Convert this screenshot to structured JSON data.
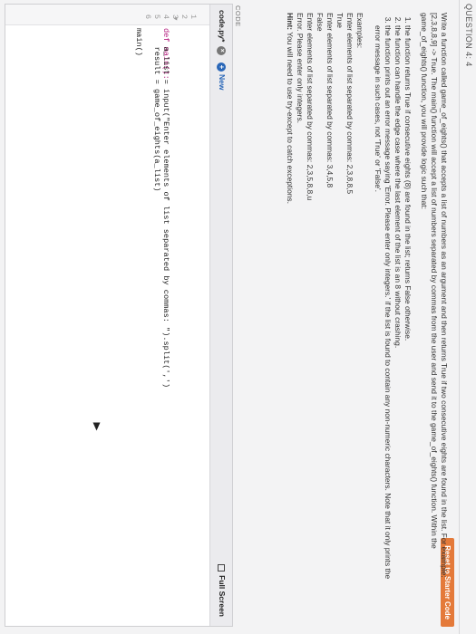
{
  "question": {
    "title": "QUESTION 4: 4"
  },
  "reset_button": {
    "label": "Reset to Starter Code"
  },
  "prompt": {
    "intro": "Write a function called game_of_eights() that accepts a list of numbers as an argument and then returns True if two consecutive eights are found in the list. For example: [2,3,8,8,9] -> True. The main() function will accept a list of numbers separated by commas from the user and send it to the game_of_eights() function. Within the game_of_eights() function, you will provide logic such that:",
    "rules": [
      "the function returns True if consecutive eights (8) are found in the list; returns False otherwise.",
      "the function can handle the edge case where the last element of the list is an 8 without crashing.",
      "the function prints out an error message saying 'Error. Please enter only integers.' if the list is found to contain any non-numeric characters. Note that it only prints the error message in such cases, not 'True' or 'False'."
    ],
    "examples_label": "Examples:",
    "examples": [
      "Enter elements of list separated by commas: 2,3,8,8,5",
      "True",
      "Enter elements of list separated by commas: 3,4,5,8",
      "False",
      "Enter elements of list separated by commas: 2,3,5,8,8,u",
      "Error. Please enter only integers."
    ],
    "hint_label": "Hint:",
    "hint_text": "You will need to use try-except to catch exceptions."
  },
  "editor": {
    "section_label": "CODE",
    "file_name": "code.py*",
    "new_label": "New",
    "fullscreen_label": "Full Screen",
    "lines": [
      {
        "num": "1",
        "text": ""
      },
      {
        "num": "2",
        "text": "def main():"
      },
      {
        "num": "3",
        "text": "    a_list = input(\"Enter elements of list separated by commas: \").split(',')"
      },
      {
        "num": "4",
        "text": "    result = game_of_eights(a_list)"
      },
      {
        "num": "5",
        "text": ""
      },
      {
        "num": "6",
        "text": "main()"
      }
    ]
  }
}
